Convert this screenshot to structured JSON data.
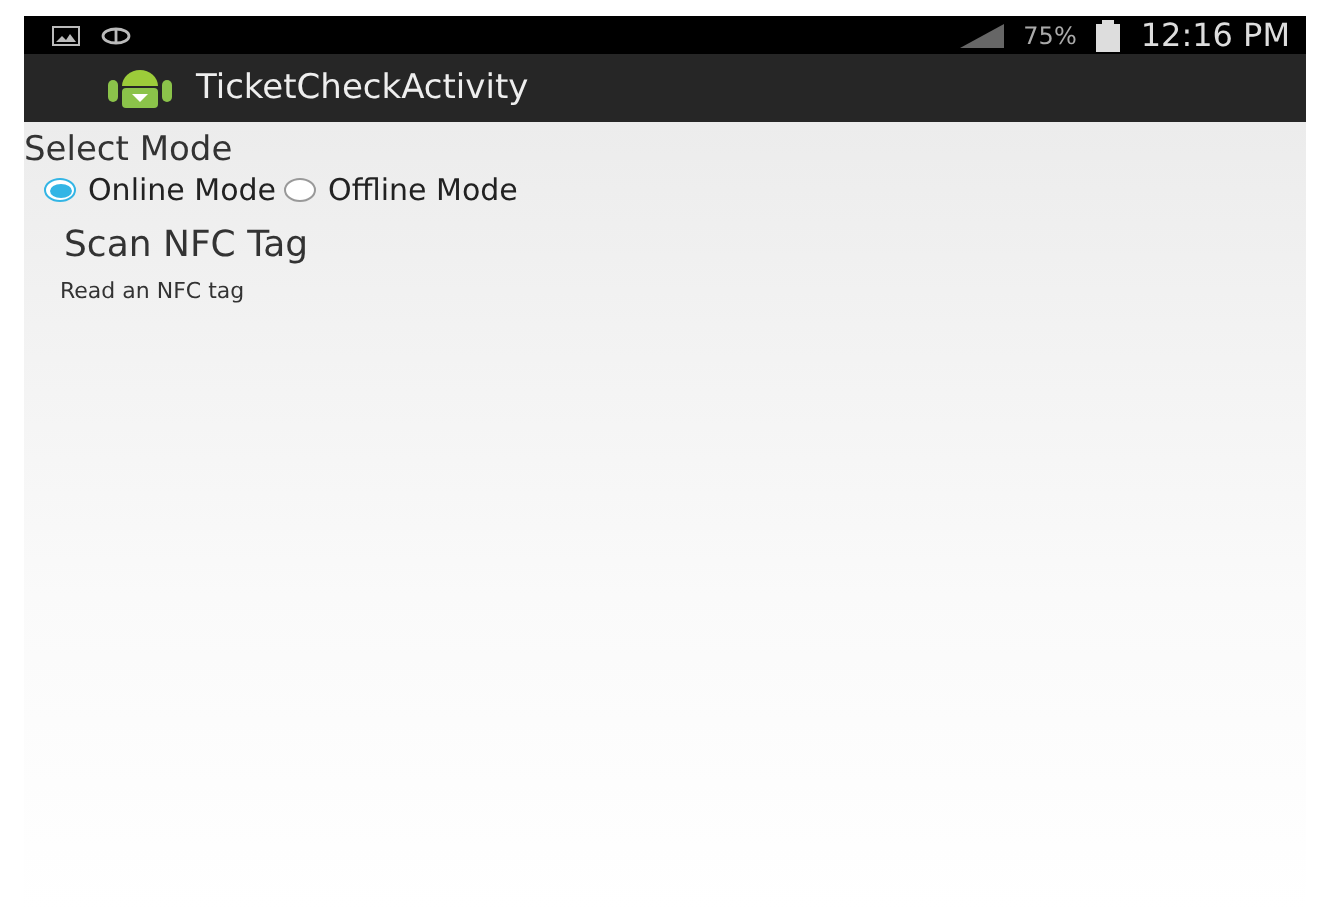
{
  "status_bar": {
    "battery": "75%",
    "time": "12:16 PM"
  },
  "action_bar": {
    "title": "TicketCheckActivity"
  },
  "mode": {
    "label": "Select Mode",
    "options": [
      {
        "label": "Online Mode",
        "selected": true
      },
      {
        "label": "Offline Mode",
        "selected": false
      }
    ]
  },
  "scan": {
    "title": "Scan NFC Tag",
    "subtitle": "Read an NFC tag"
  }
}
